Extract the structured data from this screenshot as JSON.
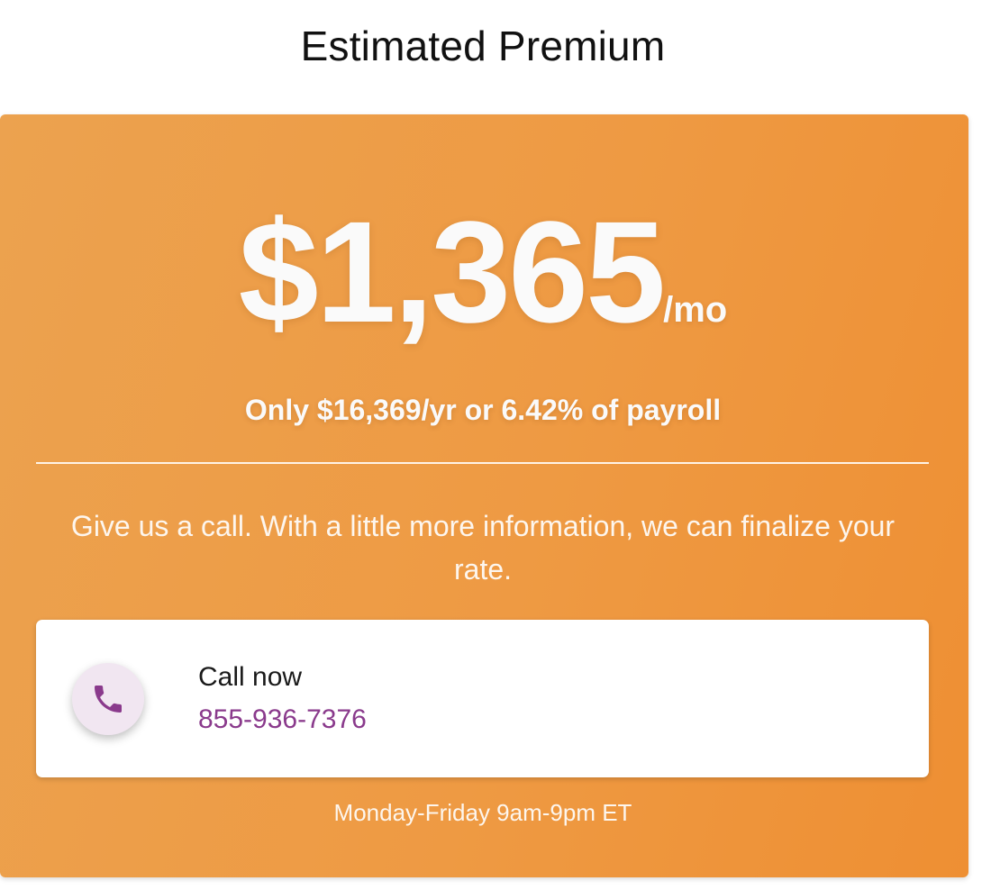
{
  "page": {
    "title": "Estimated Premium"
  },
  "premium": {
    "amount": "$1,365",
    "unit": "/mo",
    "summary": "Only $16,369/yr or 6.42% of payroll"
  },
  "message": "Give us a call. With a little more information, we can finalize your rate.",
  "call": {
    "label": "Call now",
    "number": "855-936-7376",
    "icon": "phone-icon"
  },
  "hours": "Monday-Friday 9am-9pm ET",
  "colors": {
    "card_gradient_start": "#eca24f",
    "card_gradient_end": "#ee8f33",
    "phone_accent": "#8a3a8c",
    "phone_circle_bg": "#f1e6f1"
  }
}
